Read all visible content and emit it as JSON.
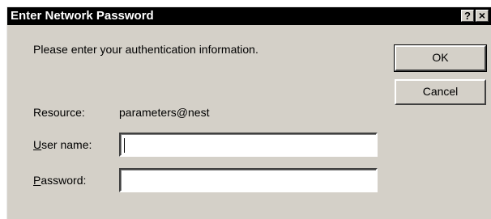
{
  "dialog": {
    "title": "Enter Network Password",
    "help_label": "?",
    "close_label": "×",
    "prompt": "Please enter your authentication information.",
    "resource_label": "Resource:",
    "resource_value": "parameters@nest",
    "username_label_hotkey": "U",
    "username_label_rest": "ser name:",
    "username_value": "",
    "password_label_hotkey": "P",
    "password_label_rest": "assword:",
    "password_value": "",
    "ok_label": "OK",
    "cancel_label": "Cancel"
  },
  "colors": {
    "face": "#d4d0c8",
    "titlebar": "#000000",
    "title_text": "#ffffff"
  }
}
